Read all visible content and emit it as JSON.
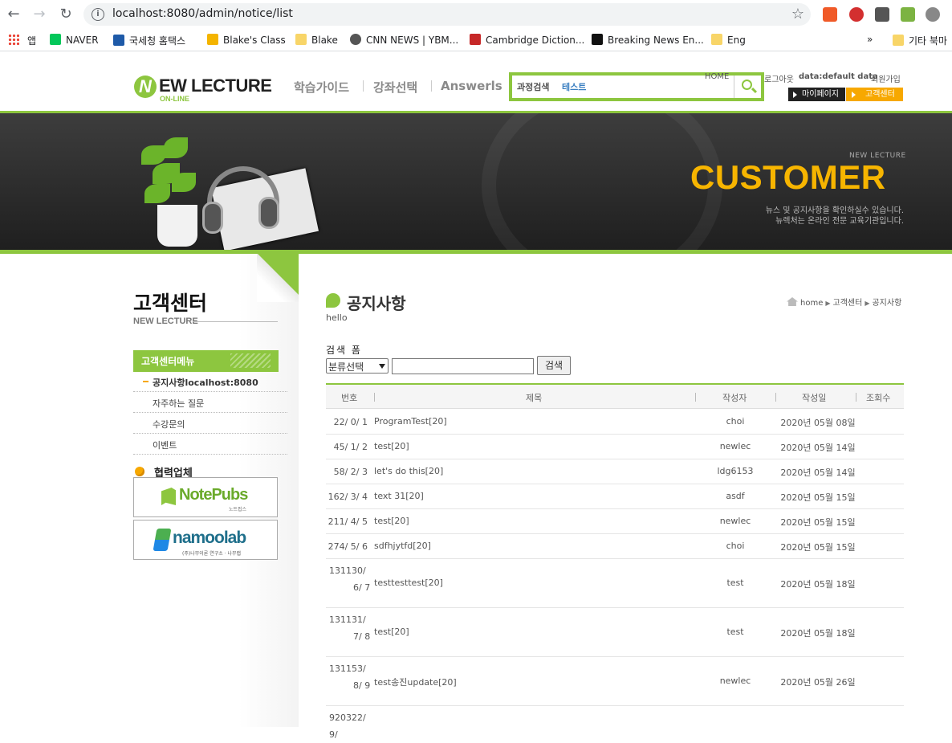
{
  "browser": {
    "url": "localhost:8080/admin/notice/list",
    "bookmarks": [
      "앱",
      "NAVER",
      "국세청 홈택스",
      "Blake's Class",
      "Blake",
      "CNN NEWS | YBM...",
      "Cambridge Diction...",
      "Breaking News En...",
      "Eng"
    ],
    "overflow": "»",
    "other_bookmarks": "기타 북마"
  },
  "header": {
    "logo_n": "N",
    "logo_text": "EW LECTURE",
    "logo_sub": "ON-LINE",
    "gnb": [
      "학습가이드",
      "강좌선택",
      "Answerls"
    ],
    "search_label": "과정검색",
    "search_value": "테스트",
    "top_links": {
      "home": "HOME",
      "logout": "로그아웃",
      "data": "data:default data",
      "join": "회원가입"
    },
    "mypage": "마이페이지",
    "customer_center": "고객센터"
  },
  "banner": {
    "small_title": "NEW LECTURE",
    "big_title": "CUSTOMER",
    "desc1": "뉴스 및 공지사항을 확인하실수 있습니다.",
    "desc2": "뉴렉처는 온라인 전문 교육기관입니다."
  },
  "side": {
    "title": "고객센터",
    "subtitle": "NEW LECTURE",
    "menu_title": "고객센터메뉴",
    "menu": [
      "공지사항localhost:8080",
      "자주하는 질문",
      "수강문의",
      "이벤트"
    ],
    "partner_title": "협력업체",
    "partners": [
      {
        "name": "NotePubs",
        "sub": "노트펍스"
      },
      {
        "name": "namoolab",
        "sub": "(주)나무이론 연구소 · 나무랩"
      }
    ]
  },
  "main": {
    "title": "공지사항",
    "hello": "hello",
    "breadcrumb": [
      "home",
      "고객센터",
      "공지사항"
    ],
    "search_form_label": "검색 폼",
    "select_value": "분류선택",
    "search_button": "검색",
    "columns": [
      "번호",
      "제목",
      "작성자",
      "작성일",
      "조회수"
    ],
    "rows": [
      {
        "no": "22/ 0/ 1",
        "title": "ProgramTest[20]",
        "writer": "choi",
        "date": "2020년 05월 08일"
      },
      {
        "no": "45/ 1/ 2",
        "title": "test[20]",
        "writer": "newlec",
        "date": "2020년 05월 14일"
      },
      {
        "no": "58/ 2/ 3",
        "title": "let's do this[20]",
        "writer": "ldg6153",
        "date": "2020년 05월 14일"
      },
      {
        "no": "162/ 3/ 4",
        "title": "text 31[20]",
        "writer": "asdf",
        "date": "2020년 05월 15일"
      },
      {
        "no": "211/ 4/ 5",
        "title": "test[20]",
        "writer": "newlec",
        "date": "2020년 05월 15일"
      },
      {
        "no": "274/ 5/ 6",
        "title": "sdfhjytfd[20]",
        "writer": "choi",
        "date": "2020년 05월 15일"
      },
      {
        "no": "131130/ 6/ 7",
        "title": "testtesttest[20]",
        "writer": "test",
        "date": "2020년 05월 18일"
      },
      {
        "no": "131131/ 7/ 8",
        "title": "test[20]",
        "writer": "test",
        "date": "2020년 05월 18일"
      },
      {
        "no": "131153/ 8/ 9",
        "title": "test송진update[20]",
        "writer": "newlec",
        "date": "2020년 05월 26일"
      },
      {
        "no": "920322/ 9/",
        "title": "",
        "writer": "",
        "date": ""
      }
    ]
  }
}
